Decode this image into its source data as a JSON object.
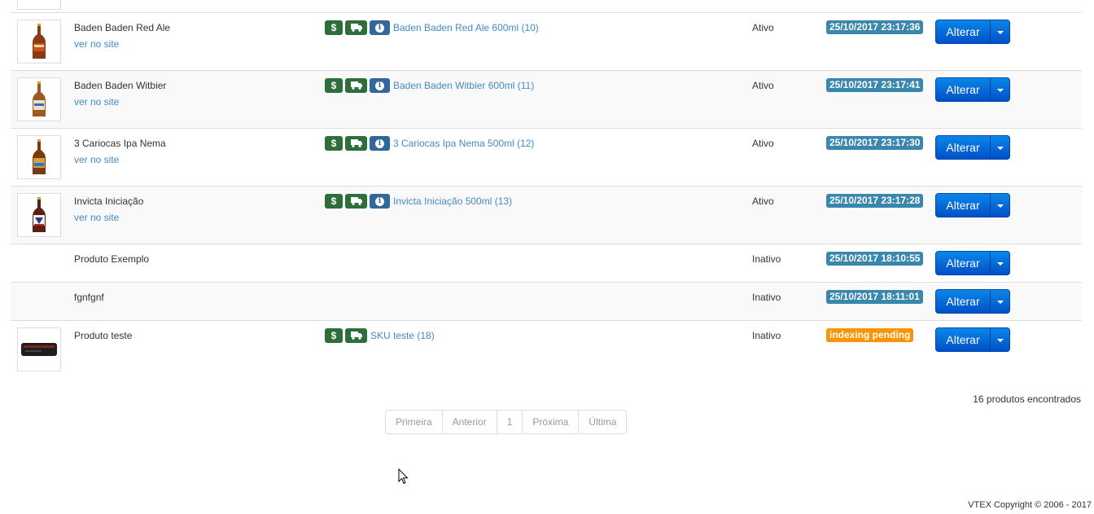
{
  "products": [
    {
      "name": "Baden Baden Red Ale",
      "site_link": "ver no site",
      "sku": "Baden Baden Red Ale 600ml (10)",
      "status": "Ativo",
      "date": "25/10/2017 23:17:36",
      "action": "Alterar"
    },
    {
      "name": "Baden Baden Witbier",
      "site_link": "ver no site",
      "sku": "Baden Baden Witbier 600ml (11)",
      "status": "Ativo",
      "date": "25/10/2017 23:17:41",
      "action": "Alterar"
    },
    {
      "name": "3 Cariocas Ipa Nema",
      "site_link": "ver no site",
      "sku": "3 Cariocas Ipa Nema 500ml (12)",
      "status": "Ativo",
      "date": "25/10/2017 23:17:30",
      "action": "Alterar"
    },
    {
      "name": "Invicta Iniciação",
      "site_link": "ver no site",
      "sku": "Invicta Iniciação 500ml (13)",
      "status": "Ativo",
      "date": "25/10/2017 23:17:28",
      "action": "Alterar"
    },
    {
      "name": "Produto Exemplo",
      "status": "Inativo",
      "date": "25/10/2017 18:10:55",
      "action": "Alterar"
    },
    {
      "name": "fgnfgnf",
      "status": "Inativo",
      "date": "25/10/2017 18:11:01",
      "action": "Alterar"
    },
    {
      "name": "Produto teste",
      "sku": "SKU teste (18)",
      "status": "Inativo",
      "date": "indexing pending",
      "action": "Alterar"
    }
  ],
  "icons": {
    "price": "dollar-icon",
    "shipping": "truck-icon",
    "info": "info-icon"
  },
  "icon_glyphs": {
    "dollar": "$",
    "info": "i"
  },
  "results_count": "16 produtos encontrados",
  "pagination": {
    "first": "Primeira",
    "prev": "Anterior",
    "page": "1",
    "next": "Próxima",
    "last": "Última"
  },
  "footer": {
    "copyright": "VTEX Copyright © 2006 - 2017"
  },
  "colors": {
    "link": "#428bca",
    "date_badge": "#3a87ad",
    "pending_badge": "#f89406",
    "button": "#0a6fd8",
    "icon_green": "#2d6e3a",
    "icon_blue": "#32679c"
  }
}
